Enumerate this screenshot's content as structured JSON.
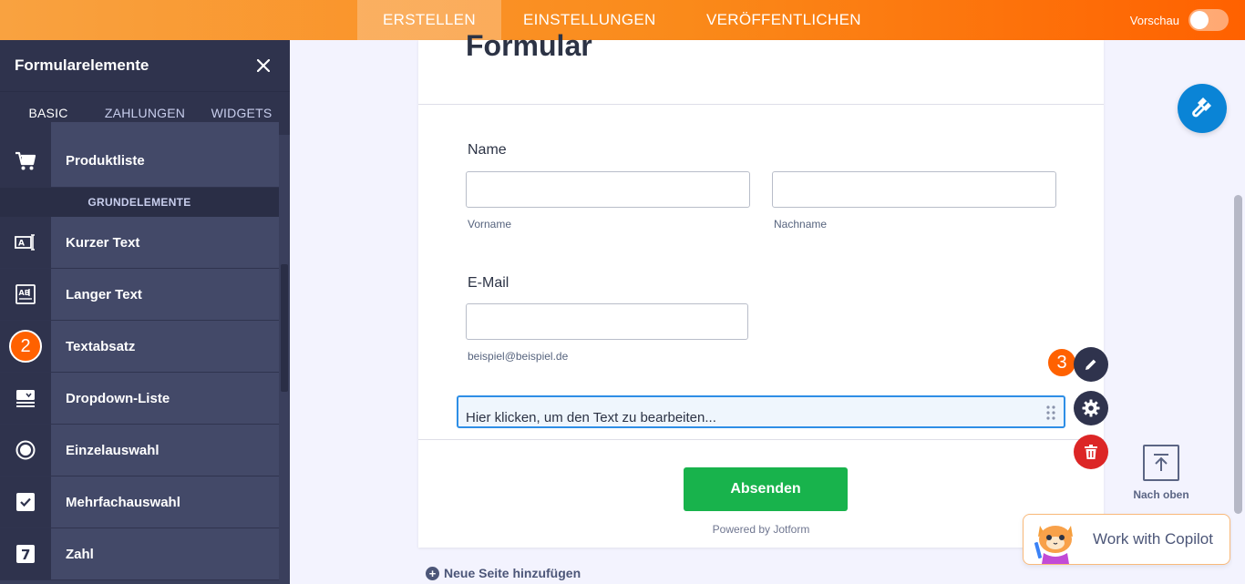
{
  "topbar": {
    "tabs": [
      {
        "label": "ERSTELLEN",
        "active": true
      },
      {
        "label": "EINSTELLUNGEN",
        "active": false
      },
      {
        "label": "VERÖFFENTLICHEN",
        "active": false
      }
    ],
    "preview_label": "Vorschau"
  },
  "sidebar": {
    "title": "Formularelemente",
    "tabs": [
      {
        "label": "BASIC",
        "active": true
      },
      {
        "label": "ZAHLUNGEN",
        "active": false
      },
      {
        "label": "WIDGETS",
        "active": false
      }
    ],
    "top_item": {
      "label": "Produktliste",
      "icon": "cart-icon"
    },
    "section_label": "GRUNDELEMENTE",
    "items": [
      {
        "label": "Kurzer Text",
        "icon": "short-text-icon"
      },
      {
        "label": "Langer Text",
        "icon": "long-text-icon"
      },
      {
        "label": "Textabsatz",
        "icon": "step-badge",
        "badge": "2"
      },
      {
        "label": "Dropdown-Liste",
        "icon": "dropdown-icon"
      },
      {
        "label": "Einzelauswahl",
        "icon": "radio-icon"
      },
      {
        "label": "Mehrfachauswahl",
        "icon": "checkbox-icon"
      },
      {
        "label": "Zahl",
        "icon": "number-icon"
      }
    ]
  },
  "form": {
    "title": "Formular",
    "name_label": "Name",
    "first_name_sublabel": "Vorname",
    "last_name_sublabel": "Nachname",
    "email_label": "E-Mail",
    "email_sublabel": "beispiel@beispiel.de",
    "paragraph_text": "Hier klicken, um den Text zu bearbeiten...",
    "submit_label": "Absenden",
    "powered_by": "Powered by Jotform"
  },
  "actions": {
    "step_badge": "3"
  },
  "scroll_top_label": "Nach oben",
  "copilot_label": "Work with Copilot",
  "new_page_label": "Neue Seite hinzufügen",
  "colors": {
    "accent": "#ff6100",
    "submit": "#18b34c",
    "delete": "#dc2626",
    "designer": "#0a84d6",
    "sidebar": "#3a3f5c"
  }
}
